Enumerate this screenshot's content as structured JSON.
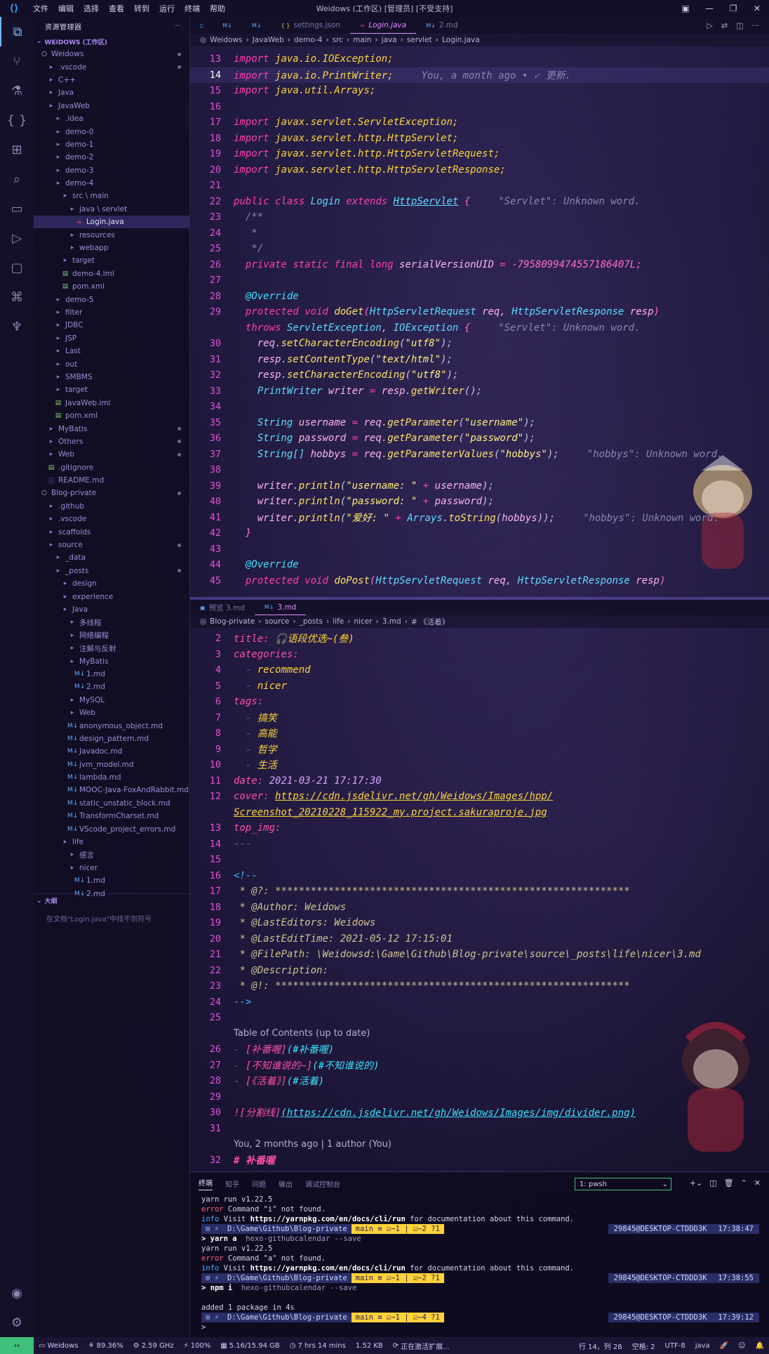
{
  "window": {
    "title": "Weidows (工作区) [管理员] [不受支持]",
    "menu": [
      "文件",
      "编辑",
      "选择",
      "查看",
      "转到",
      "运行",
      "终端",
      "帮助"
    ]
  },
  "sidebar": {
    "header": "资源管理器",
    "section": "WEIDOWS (工作区)",
    "outline_header": "大纲",
    "outline_message": "在文档\"Login.java\"中找不到符号",
    "tree": [
      {
        "label": "Weidows",
        "depth": 0,
        "icon": "circle",
        "dot": true
      },
      {
        "label": ".vscode",
        "depth": 1,
        "icon": "folder",
        "dot": true
      },
      {
        "label": "C++",
        "depth": 1,
        "icon": "folder"
      },
      {
        "label": "Java",
        "depth": 1,
        "icon": "folder"
      },
      {
        "label": "JavaWeb",
        "depth": 1,
        "icon": "folder"
      },
      {
        "label": ".idea",
        "depth": 2,
        "icon": "folder"
      },
      {
        "label": "demo-0",
        "depth": 2,
        "icon": "folder"
      },
      {
        "label": "demo-1",
        "depth": 2,
        "icon": "folder"
      },
      {
        "label": "demo-2",
        "depth": 2,
        "icon": "folder"
      },
      {
        "label": "demo-3",
        "depth": 2,
        "icon": "folder"
      },
      {
        "label": "demo-4",
        "depth": 2,
        "icon": "folder"
      },
      {
        "label": "src \\ main",
        "depth": 3,
        "icon": "folder"
      },
      {
        "label": "java \\ servlet",
        "depth": 4,
        "icon": "folder"
      },
      {
        "label": "Login.java",
        "depth": 5,
        "icon": "java",
        "selected": true
      },
      {
        "label": "resources",
        "depth": 4,
        "icon": "folder"
      },
      {
        "label": "webapp",
        "depth": 4,
        "icon": "folder"
      },
      {
        "label": "target",
        "depth": 3,
        "icon": "folder"
      },
      {
        "label": "demo-4.iml",
        "depth": 3,
        "icon": "file"
      },
      {
        "label": "pom.xml",
        "depth": 3,
        "icon": "file"
      },
      {
        "label": "demo-5",
        "depth": 2,
        "icon": "folder"
      },
      {
        "label": "filter",
        "depth": 2,
        "icon": "folder"
      },
      {
        "label": "JDBC",
        "depth": 2,
        "icon": "folder"
      },
      {
        "label": "JSP",
        "depth": 2,
        "icon": "folder"
      },
      {
        "label": "Last",
        "depth": 2,
        "icon": "folder"
      },
      {
        "label": "out",
        "depth": 2,
        "icon": "folder"
      },
      {
        "label": "SMBMS",
        "depth": 2,
        "icon": "folder"
      },
      {
        "label": "target",
        "depth": 2,
        "icon": "folder"
      },
      {
        "label": "JavaWeb.iml",
        "depth": 2,
        "icon": "file"
      },
      {
        "label": "pom.xml",
        "depth": 2,
        "icon": "file"
      },
      {
        "label": "MyBatis",
        "depth": 1,
        "icon": "folder",
        "dot": true
      },
      {
        "label": "Others",
        "depth": 1,
        "icon": "folder",
        "dot": true
      },
      {
        "label": "Web",
        "depth": 1,
        "icon": "folder",
        "dot": true
      },
      {
        "label": ".gitignore",
        "depth": 1,
        "icon": "file"
      },
      {
        "label": "README.md",
        "depth": 1,
        "icon": "info"
      },
      {
        "label": "Blog-private",
        "depth": 0,
        "icon": "circle",
        "dot": true
      },
      {
        "label": ".github",
        "depth": 1,
        "icon": "folder"
      },
      {
        "label": ".vscode",
        "depth": 1,
        "icon": "folder"
      },
      {
        "label": "scaffolds",
        "depth": 1,
        "icon": "folder"
      },
      {
        "label": "source",
        "depth": 1,
        "icon": "folder",
        "dot": true
      },
      {
        "label": "_data",
        "depth": 2,
        "icon": "folder"
      },
      {
        "label": "_posts",
        "depth": 2,
        "icon": "folder",
        "dot": true
      },
      {
        "label": "design",
        "depth": 3,
        "icon": "folder"
      },
      {
        "label": "experience",
        "depth": 3,
        "icon": "folder"
      },
      {
        "label": "Java",
        "depth": 3,
        "icon": "folder"
      },
      {
        "label": "多线程",
        "depth": 4,
        "icon": "folder"
      },
      {
        "label": "网络编程",
        "depth": 4,
        "icon": "folder"
      },
      {
        "label": "注解与反射",
        "depth": 4,
        "icon": "folder"
      },
      {
        "label": "MyBatis",
        "depth": 4,
        "icon": "folder"
      },
      {
        "label": "1.md",
        "depth": 5,
        "icon": "md"
      },
      {
        "label": "2.md",
        "depth": 5,
        "icon": "md"
      },
      {
        "label": "MySQL",
        "depth": 4,
        "icon": "folder"
      },
      {
        "label": "Web",
        "depth": 4,
        "icon": "folder"
      },
      {
        "label": "anonymous_object.md",
        "depth": 4,
        "icon": "md"
      },
      {
        "label": "design_pattern.md",
        "depth": 4,
        "icon": "md"
      },
      {
        "label": "Javadoc.md",
        "depth": 4,
        "icon": "md"
      },
      {
        "label": "jvm_model.md",
        "depth": 4,
        "icon": "md"
      },
      {
        "label": "lambda.md",
        "depth": 4,
        "icon": "md"
      },
      {
        "label": "MOOC-Java-FoxAndRabbit.md",
        "depth": 4,
        "icon": "md"
      },
      {
        "label": "static_unstatic_block.md",
        "depth": 4,
        "icon": "md"
      },
      {
        "label": "TransformCharset.md",
        "depth": 4,
        "icon": "md"
      },
      {
        "label": "VScode_project_errors.md",
        "depth": 4,
        "icon": "md"
      },
      {
        "label": "life",
        "depth": 3,
        "icon": "folder"
      },
      {
        "label": "感言",
        "depth": 4,
        "icon": "folder"
      },
      {
        "label": "nicer",
        "depth": 4,
        "icon": "folder"
      },
      {
        "label": "1.md",
        "depth": 5,
        "icon": "md"
      },
      {
        "label": "2.md",
        "depth": 5,
        "icon": "md"
      }
    ]
  },
  "editor_top": {
    "tabs": [
      {
        "label": "",
        "icon": "M↓"
      },
      {
        "label": "",
        "icon": "M↓"
      },
      {
        "label": "",
        "icon": "M↓"
      },
      {
        "label": "settings.json",
        "icon": "{ }"
      },
      {
        "label": "Login.java",
        "icon": "☕",
        "active": true
      },
      {
        "label": "2.md",
        "icon": "M↓"
      }
    ],
    "breadcrumb": [
      "Weidows",
      "JavaWeb",
      "demo-4",
      "src",
      "main",
      "java",
      "servlet",
      "Login.java"
    ],
    "blame": "You, a month ago • ✓ 更新.",
    "unknown_servlet": "\"Servlet\": Unknown word.",
    "unknown_hobbys": "\"hobbys\": Unknown word."
  },
  "editor_bottom": {
    "tabs": [
      {
        "label": "预览 3.md",
        "icon": "▣"
      },
      {
        "label": "3.md",
        "icon": "M↓",
        "active": true
      }
    ],
    "breadcrumb": [
      "Blog-private",
      "source",
      "_posts",
      "life",
      "nicer",
      "3.md",
      "# 《活着》"
    ],
    "toc_title": "Table of Contents (up to date)",
    "blame_lens": "You, 2 months ago | 1 author (You)"
  },
  "panel": {
    "tabs": [
      "终端",
      "知乎",
      "问题",
      "输出",
      "调试控制台"
    ],
    "terminal_select": "1: pwsh",
    "lines": [
      {
        "kind": "plain",
        "text": "yarn run v1.22.5"
      },
      {
        "kind": "error",
        "prefix": "error",
        "text": " Command \"i\" not found."
      },
      {
        "kind": "info",
        "prefix": "info",
        "pre": " Visit ",
        "bold": "https://yarnpkg.com/en/docs/cli/run",
        "post": " for documentation about this command."
      },
      {
        "kind": "prompt",
        "path": "D:\\Game\\Github\\Blog-private",
        "branch": "main ≡ ☑~1 | ☑~2 ?1",
        "host": "29845@DESKTOP-CTDDD3K",
        "time": "17:38:47"
      },
      {
        "kind": "cmd",
        "cmd": "> yarn a",
        "arg": "  hexo-githubcalendar --save"
      },
      {
        "kind": "plain",
        "text": "yarn run v1.22.5"
      },
      {
        "kind": "error",
        "prefix": "error",
        "text": " Command \"a\" not found."
      },
      {
        "kind": "info",
        "prefix": "info",
        "pre": " Visit ",
        "bold": "https://yarnpkg.com/en/docs/cli/run",
        "post": " for documentation about this command."
      },
      {
        "kind": "prompt",
        "path": "D:\\Game\\Github\\Blog-private",
        "branch": "main ≡ ☑~1 | ☑~2 ?1",
        "host": "29845@DESKTOP-CTDDD3K",
        "time": "17:38:55"
      },
      {
        "kind": "cmd",
        "cmd": "> npm i",
        "arg": "  hexo-githubcalendar --save"
      },
      {
        "kind": "plain",
        "text": ""
      },
      {
        "kind": "plain",
        "text": "added 1 package in 4s"
      },
      {
        "kind": "prompt",
        "path": "D:\\Game\\Github\\Blog-private",
        "branch": "main ≡ ☑~1 | ☑~4 ?1",
        "host": "29845@DESKTOP-CTDDD3K",
        "time": "17:39:12"
      },
      {
        "kind": "cursor",
        "text": "> "
      }
    ]
  },
  "statusbar": {
    "left": [
      "Weidows",
      "89.36%",
      "2.59 GHz",
      "100%",
      "5.16/15.94 GB",
      "7 hrs 14 mins",
      "1.52 KB",
      "正在激活扩展..."
    ],
    "right": [
      "行 14，列 28",
      "空格: 2",
      "UTF-8",
      "java"
    ]
  }
}
